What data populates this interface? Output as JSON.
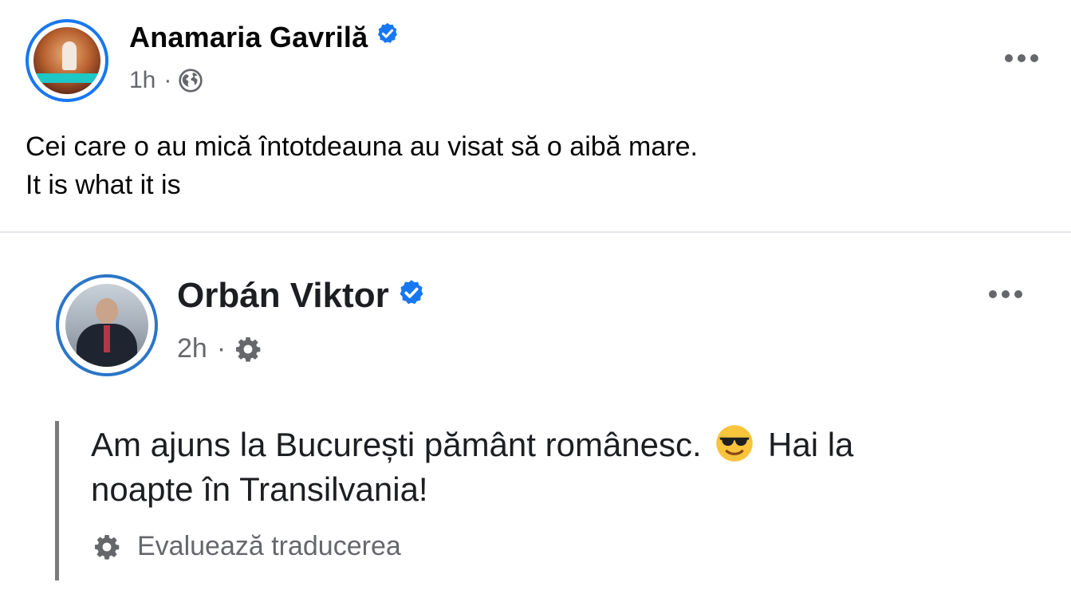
{
  "post": {
    "author": "Anamaria Gavrilă",
    "time": "1h",
    "separator": "·",
    "audience_icon": "globe-icon",
    "text_line1": "Cei care o au mică întotdeauna au visat să o aibă mare.",
    "text_line2": "It is what it is"
  },
  "shared_post": {
    "author": "Orbán Viktor",
    "time": "2h",
    "separator": "·",
    "audience_icon": "gear-icon",
    "text_line1_before_emoji": "Am ajuns la București pământ românesc.",
    "emoji": "smiling-face-with-sunglasses",
    "text_line1_after_emoji": "Hai la",
    "text_line2": "noapte în Transilvania!",
    "rate_translation": "Evaluează traducerea"
  },
  "colors": {
    "verified_blue": "#1877f2",
    "secondary_text": "#65676b",
    "divider": "#e4e6eb"
  }
}
